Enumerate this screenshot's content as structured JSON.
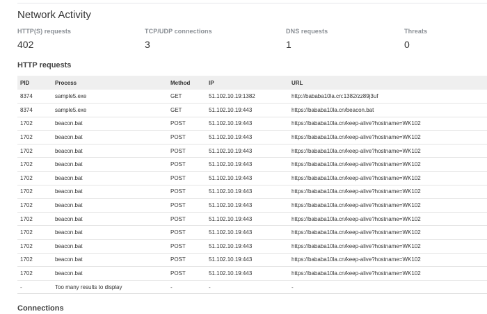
{
  "page": {
    "title": "Network Activity"
  },
  "stats": [
    {
      "label": "HTTP(S) requests",
      "value": "402"
    },
    {
      "label": "TCP/UDP connections",
      "value": "3"
    },
    {
      "label": "DNS requests",
      "value": "1"
    },
    {
      "label": "Threats",
      "value": "0"
    }
  ],
  "http_section": {
    "title": "HTTP requests",
    "columns": [
      "PID",
      "Process",
      "Method",
      "IP",
      "URL"
    ],
    "rows": [
      [
        "8374",
        "sample5.exe",
        "GET",
        "51.102.10.19:1382",
        "http://bababa10la.cn:1382/zz89j3uf"
      ],
      [
        "8374",
        "sample5.exe",
        "GET",
        "51.102.10.19:443",
        "https://bababa10la.cn/beacon.bat"
      ],
      [
        "1702",
        "beacon.bat",
        "POST",
        "51.102.10.19:443",
        "https://bababa10la.cn/keep-alive?hostname=WK102"
      ],
      [
        "1702",
        "beacon.bat",
        "POST",
        "51.102.10.19:443",
        "https://bababa10la.cn/keep-alive?hostname=WK102"
      ],
      [
        "1702",
        "beacon.bat",
        "POST",
        "51.102.10.19:443",
        "https://bababa10la.cn/keep-alive?hostname=WK102"
      ],
      [
        "1702",
        "beacon.bat",
        "POST",
        "51.102.10.19:443",
        "https://bababa10la.cn/keep-alive?hostname=WK102"
      ],
      [
        "1702",
        "beacon.bat",
        "POST",
        "51.102.10.19:443",
        "https://bababa10la.cn/keep-alive?hostname=WK102"
      ],
      [
        "1702",
        "beacon.bat",
        "POST",
        "51.102.10.19:443",
        "https://bababa10la.cn/keep-alive?hostname=WK102"
      ],
      [
        "1702",
        "beacon.bat",
        "POST",
        "51.102.10.19:443",
        "https://bababa10la.cn/keep-alive?hostname=WK102"
      ],
      [
        "1702",
        "beacon.bat",
        "POST",
        "51.102.10.19:443",
        "https://bababa10la.cn/keep-alive?hostname=WK102"
      ],
      [
        "1702",
        "beacon.bat",
        "POST",
        "51.102.10.19:443",
        "https://bababa10la.cn/keep-alive?hostname=WK102"
      ],
      [
        "1702",
        "beacon.bat",
        "POST",
        "51.102.10.19:443",
        "https://bababa10la.cn/keep-alive?hostname=WK102"
      ],
      [
        "1702",
        "beacon.bat",
        "POST",
        "51.102.10.19:443",
        "https://bababa10la.cn/keep-alive?hostname=WK102"
      ],
      [
        "1702",
        "beacon.bat",
        "POST",
        "51.102.10.19:443",
        "https://bababa10la.cn/keep-alive?hostname=WK102"
      ],
      [
        "-",
        "Too many results to display",
        "-",
        "-",
        "-"
      ]
    ]
  },
  "connections_section": {
    "title": "Connections"
  }
}
